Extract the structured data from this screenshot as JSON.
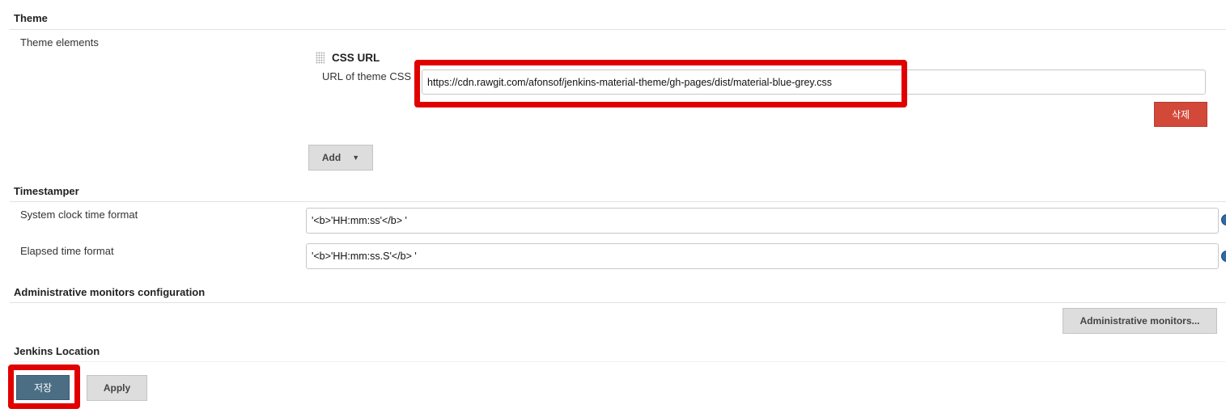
{
  "theme": {
    "heading": "Theme",
    "elements_label": "Theme elements",
    "css_url": {
      "title": "CSS URL",
      "label": "URL of theme CSS",
      "value": "https://cdn.rawgit.com/afonsof/jenkins-material-theme/gh-pages/dist/material-blue-grey.css",
      "delete_label": "삭제"
    },
    "add_label": "Add"
  },
  "timestamper": {
    "heading": "Timestamper",
    "system_label": "System clock time format",
    "system_value": "'<b>'HH:mm:ss'</b> '",
    "elapsed_label": "Elapsed time format",
    "elapsed_value": "'<b>'HH:mm:ss.S'</b> '"
  },
  "admin": {
    "heading": "Administrative monitors configuration",
    "button_label": "Administrative monitors..."
  },
  "location": {
    "heading": "Jenkins Location"
  },
  "footer": {
    "save_label": "저장",
    "apply_label": "Apply"
  },
  "colors": {
    "highlight": "#e00000",
    "delete": "#d24939",
    "save": "#4b6e85"
  }
}
